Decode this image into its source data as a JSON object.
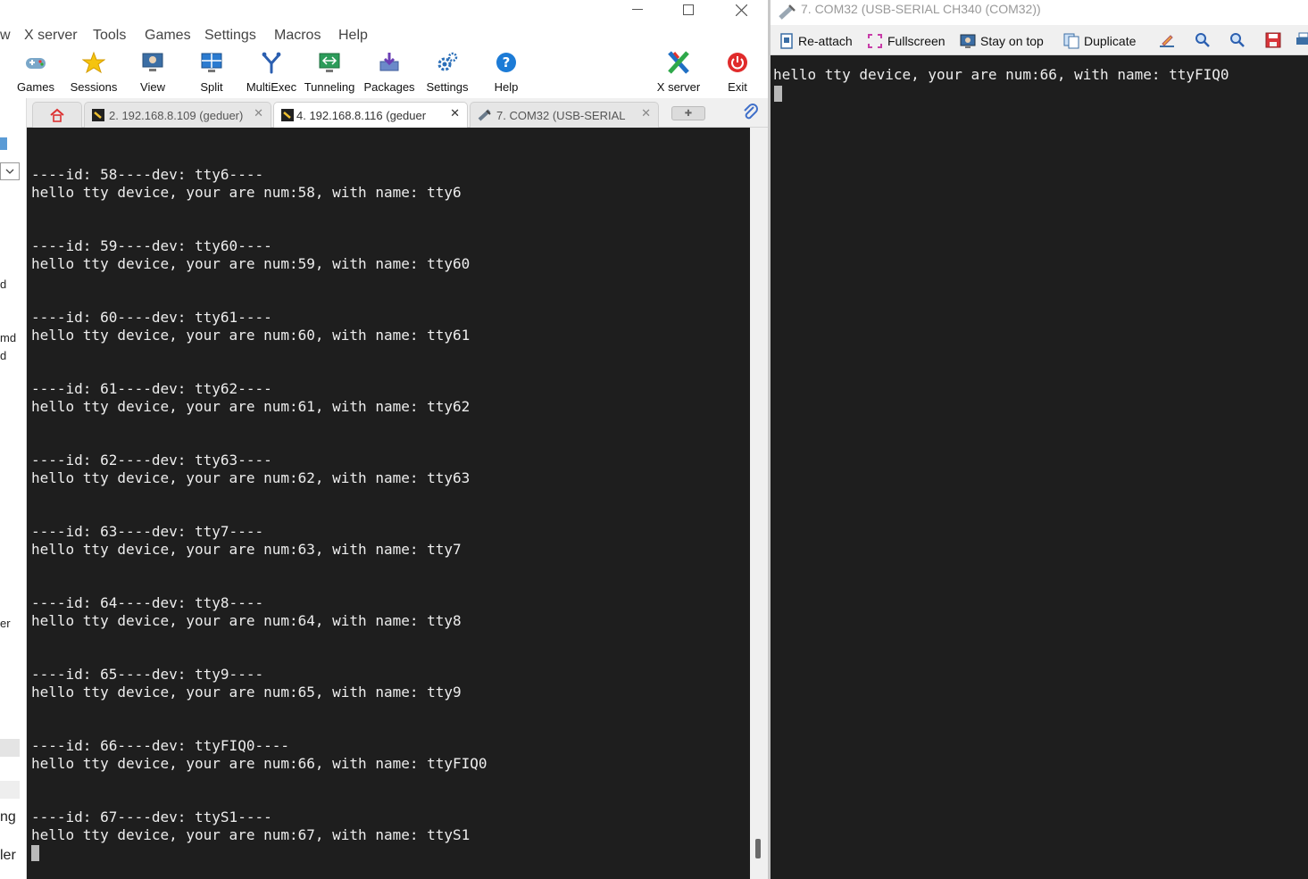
{
  "left_window": {
    "menu": [
      "w",
      "X server",
      "Tools",
      "Games",
      "Settings",
      "Macros",
      "Help"
    ],
    "toolbar": [
      {
        "label": "Games",
        "icon": "gamepad-icon"
      },
      {
        "label": "Sessions",
        "icon": "star-icon"
      },
      {
        "label": "View",
        "icon": "monitor-view-icon"
      },
      {
        "label": "Split",
        "icon": "split-icon"
      },
      {
        "label": "MultiExec",
        "icon": "fork-icon"
      },
      {
        "label": "Tunneling",
        "icon": "tunnel-icon"
      },
      {
        "label": "Packages",
        "icon": "package-icon"
      },
      {
        "label": "Settings",
        "icon": "gears-icon"
      },
      {
        "label": "Help",
        "icon": "help-icon"
      },
      {
        "label": "X server",
        "icon": "x-server-icon"
      },
      {
        "label": "Exit",
        "icon": "power-icon"
      }
    ],
    "tabs": [
      {
        "label": "2. 192.168.8.109 (geduer)",
        "active": false
      },
      {
        "label": "4. 192.168.8.116 (geduer",
        "active": true
      },
      {
        "label": "7. COM32  (USB-SERIAL",
        "active": false
      }
    ],
    "sidebar_fragments": [
      "d",
      "md",
      "d",
      "er",
      "ng",
      "ler"
    ],
    "terminal_lines": [
      "----id: 58----dev: tty6----",
      "hello tty device, your are num:58, with name: tty6",
      "----id: 59----dev: tty60----",
      "hello tty device, your are num:59, with name: tty60",
      "----id: 60----dev: tty61----",
      "hello tty device, your are num:60, with name: tty61",
      "----id: 61----dev: tty62----",
      "hello tty device, your are num:61, with name: tty62",
      "----id: 62----dev: tty63----",
      "hello tty device, your are num:62, with name: tty63",
      "----id: 63----dev: tty7----",
      "hello tty device, your are num:63, with name: tty7",
      "----id: 64----dev: tty8----",
      "hello tty device, your are num:64, with name: tty8",
      "----id: 65----dev: tty9----",
      "hello tty device, your are num:65, with name: tty9",
      "----id: 66----dev: ttyFIQ0----",
      "hello tty device, your are num:66, with name: ttyFIQ0",
      "----id: 67----dev: ttyS1----",
      "hello tty device, your are num:67, with name: ttyS1"
    ]
  },
  "right_window": {
    "title": "7. COM32  (USB-SERIAL CH340 (COM32))",
    "toolbar": [
      {
        "label": "Re-attach",
        "icon": "reattach-icon"
      },
      {
        "label": "Fullscreen",
        "icon": "fullscreen-icon"
      },
      {
        "label": "Stay on top",
        "icon": "stay-on-top-icon"
      },
      {
        "label": "Duplicate",
        "icon": "duplicate-icon"
      }
    ],
    "terminal_lines": [
      "hello tty device, your are num:66, with name: ttyFIQ0"
    ]
  },
  "colors": {
    "terminal_bg": "#1e1e1e",
    "terminal_fg": "#ededed",
    "accent_blue": "#1c7bd6",
    "exit_red": "#e02b2b"
  }
}
